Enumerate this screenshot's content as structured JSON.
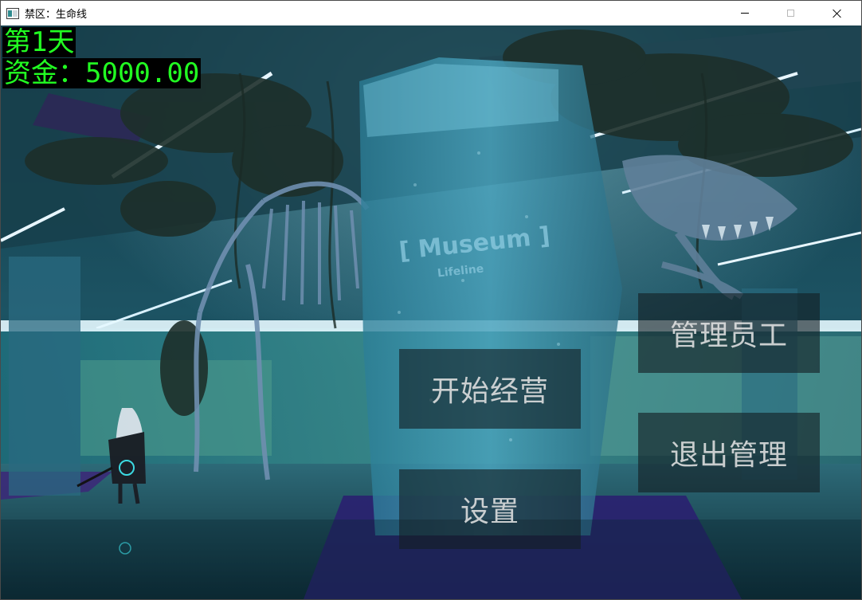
{
  "window": {
    "title": "禁区：生命线",
    "icon": "app-window-icon",
    "controls": {
      "minimize_icon": "minimize-icon",
      "maximize_icon": "maximize-icon",
      "close_icon": "close-icon"
    }
  },
  "hud": {
    "day_label": "第1天",
    "money_label": "资金：5000.00",
    "text_color": "#22ff22",
    "background_color": "#000000"
  },
  "scene": {
    "sign_title": "[ Museum ]",
    "sign_subtitle": "Lifeline"
  },
  "menu": {
    "start_label": "开始经营",
    "staff_label": "管理员工",
    "exit_label": "退出管理",
    "settings_label": "设置"
  }
}
